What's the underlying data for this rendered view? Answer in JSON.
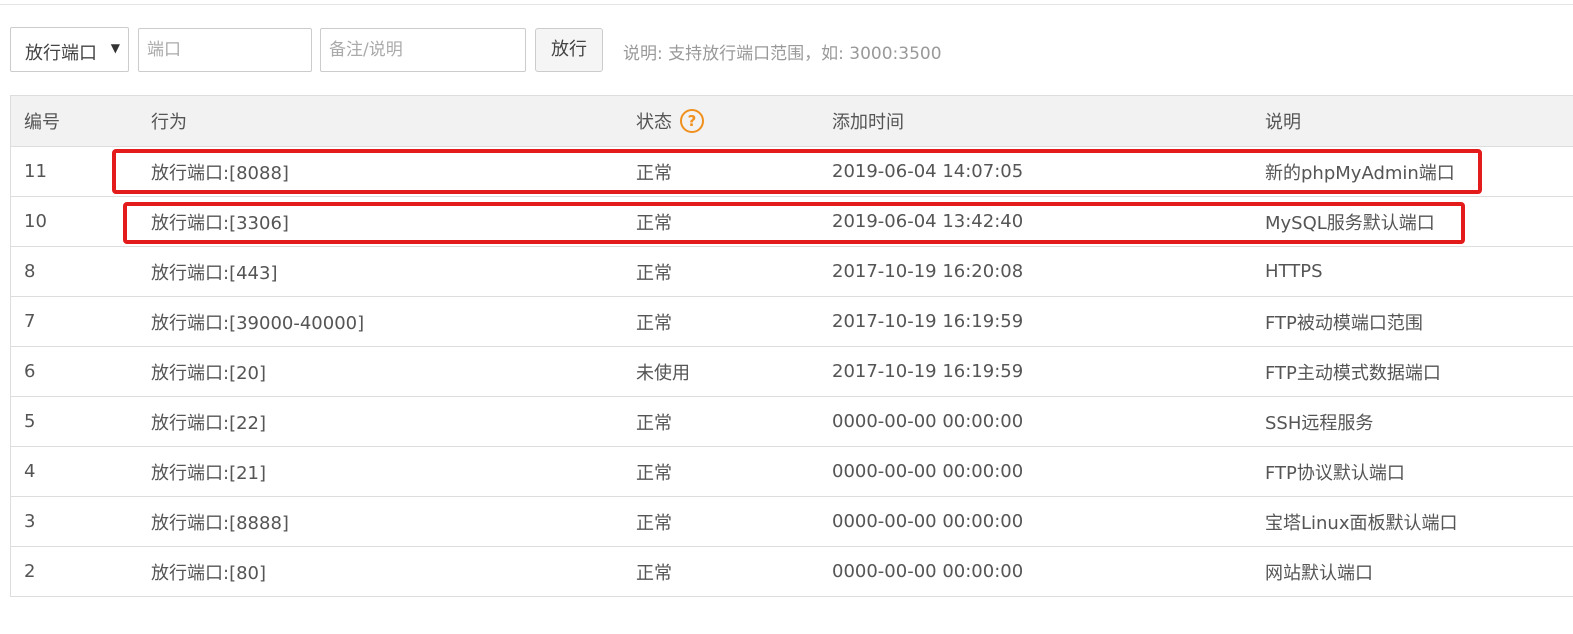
{
  "toolbar": {
    "select_value": "放行端口",
    "port_placeholder": "端口",
    "note_placeholder": "备注/说明",
    "submit_label": "放行",
    "hint": "说明: 支持放行端口范围，如: 3000:3500"
  },
  "table": {
    "headers": {
      "id": "编号",
      "action": "行为",
      "state": "状态",
      "time": "添加时间",
      "desc": "说明"
    },
    "help_glyph": "?",
    "rows": [
      {
        "id": "11",
        "action": "放行端口:[8088]",
        "state": "正常",
        "time": "2019-06-04 14:07:05",
        "desc": "新的phpMyAdmin端口"
      },
      {
        "id": "10",
        "action": "放行端口:[3306]",
        "state": "正常",
        "time": "2019-06-04 13:42:40",
        "desc": "MySQL服务默认端口"
      },
      {
        "id": "8",
        "action": "放行端口:[443]",
        "state": "正常",
        "time": "2017-10-19 16:20:08",
        "desc": "HTTPS"
      },
      {
        "id": "7",
        "action": "放行端口:[39000-40000]",
        "state": "正常",
        "time": "2017-10-19 16:19:59",
        "desc": "FTP被动模端口范围"
      },
      {
        "id": "6",
        "action": "放行端口:[20]",
        "state": "未使用",
        "time": "2017-10-19 16:19:59",
        "desc": "FTP主动模式数据端口"
      },
      {
        "id": "5",
        "action": "放行端口:[22]",
        "state": "正常",
        "time": "0000-00-00 00:00:00",
        "desc": "SSH远程服务"
      },
      {
        "id": "4",
        "action": "放行端口:[21]",
        "state": "正常",
        "time": "0000-00-00 00:00:00",
        "desc": "FTP协议默认端口"
      },
      {
        "id": "3",
        "action": "放行端口:[8888]",
        "state": "正常",
        "time": "0000-00-00 00:00:00",
        "desc": "宝塔Linux面板默认端口"
      },
      {
        "id": "2",
        "action": "放行端口:[80]",
        "state": "正常",
        "time": "0000-00-00 00:00:00",
        "desc": "网站默认端口"
      }
    ]
  },
  "colors": {
    "highlight": "#e31b1b",
    "help_icon": "#f0901e",
    "header_bg": "#f2f2f2"
  }
}
